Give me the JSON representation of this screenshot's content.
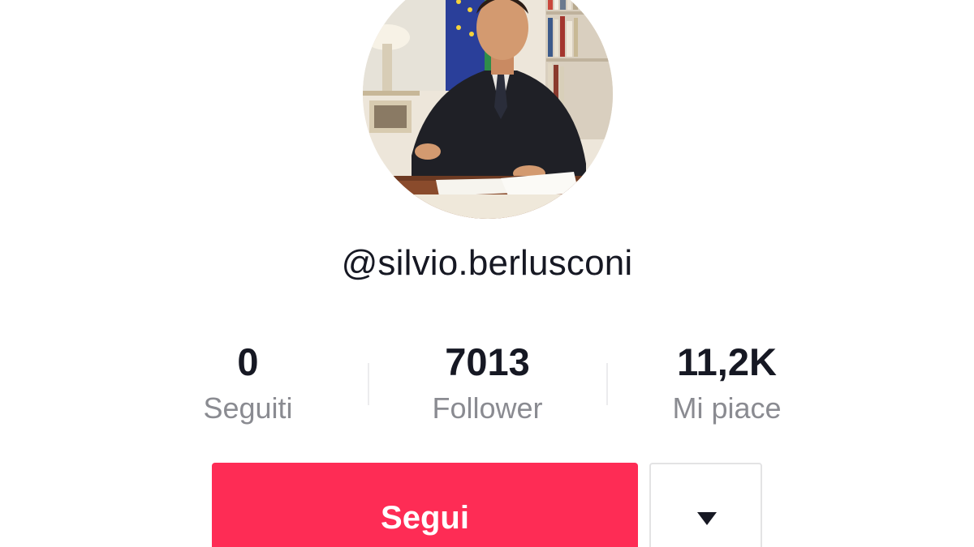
{
  "profile": {
    "username": "@silvio.berlusconi"
  },
  "stats": [
    {
      "value": "0",
      "label": "Seguiti"
    },
    {
      "value": "7013",
      "label": "Follower"
    },
    {
      "value": "11,2K",
      "label": "Mi piace"
    }
  ],
  "actions": {
    "follow_label": "Segui",
    "dropdown_icon": "caret-down-icon"
  },
  "colors": {
    "accent": "#fe2c55",
    "text_primary": "#161823",
    "text_secondary": "#8a8b91"
  }
}
